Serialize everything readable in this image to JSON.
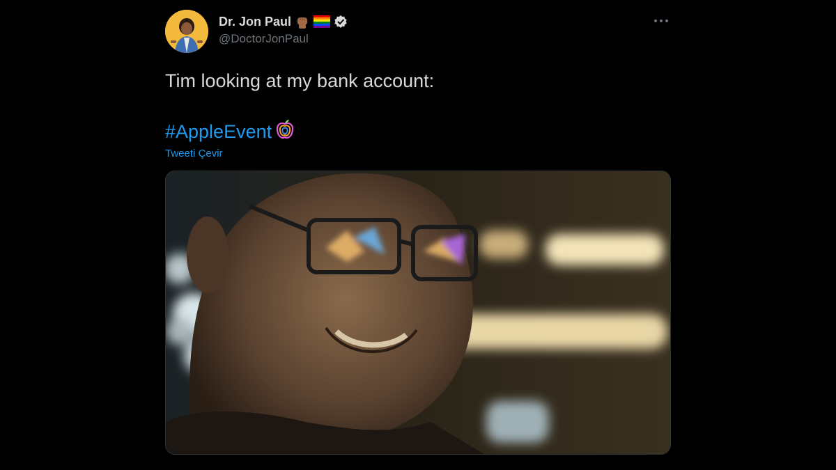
{
  "author": {
    "display_name": "Dr. Jon Paul",
    "handle": "@DoctorJonPaul",
    "badges": [
      "raised-fist-emoji",
      "rainbow-flag-emoji",
      "verified-badge"
    ]
  },
  "menu": {
    "icon": "more-horizontal-icon"
  },
  "tweet": {
    "text": "Tim looking at my bank account:",
    "hashtag": "#AppleEvent",
    "hashtag_emoji": "apple-event-logo",
    "translate_label": "Tweeti Çevir"
  },
  "media": {
    "type": "photo",
    "subject": "smiling-man-with-glasses-photo"
  },
  "colors": {
    "background": "#000000",
    "text": "#d9d9d9",
    "secondary": "#6e767d",
    "link": "#1d9bf0"
  }
}
